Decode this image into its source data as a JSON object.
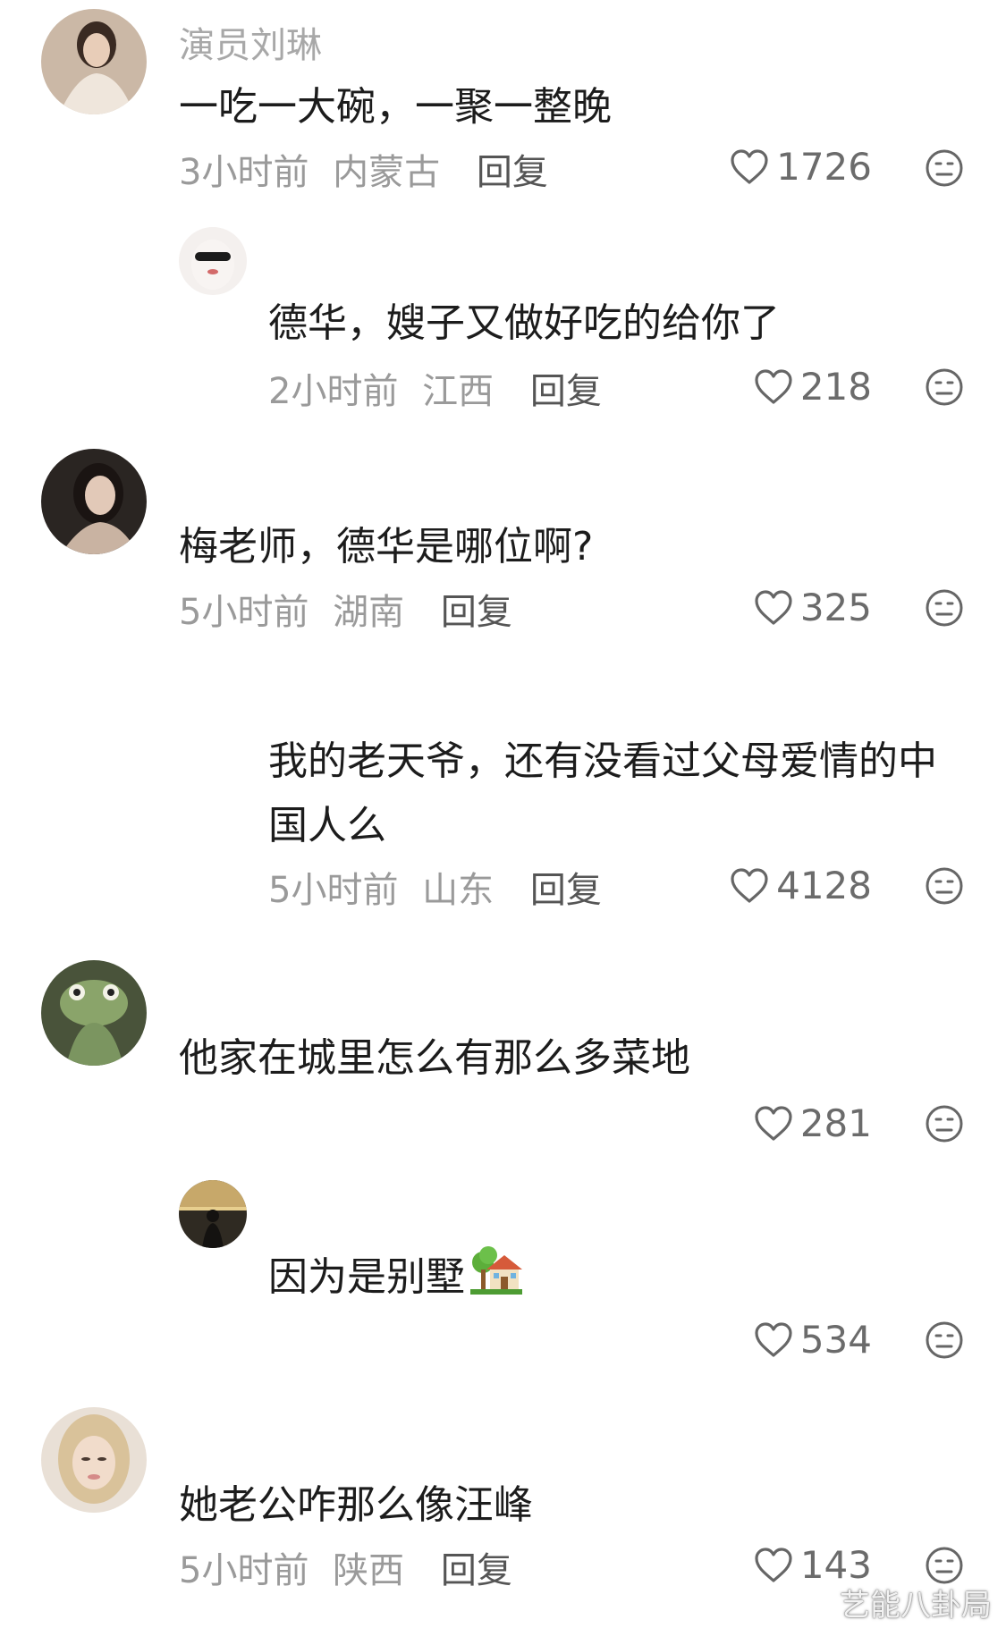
{
  "comments": [
    {
      "username": "演员刘琳",
      "text": "一吃一大碗，一聚一整晚",
      "time": "3小时前",
      "location": "内蒙古",
      "reply_label": "回复",
      "likes": "1726"
    },
    {
      "text": "德华，嫂子又做好吃的给你了",
      "time": "2小时前",
      "location": "江西",
      "reply_label": "回复",
      "likes": "218"
    },
    {
      "text": "梅老师，德华是哪位啊?",
      "time": "5小时前",
      "location": "湖南",
      "reply_label": "回复",
      "likes": "325"
    },
    {
      "text_line1": "我的老天爷，还有没看过父母爱情的中",
      "text_line2": "国人么",
      "time": "5小时前",
      "location": "山东",
      "reply_label": "回复",
      "likes": "4128"
    },
    {
      "text": "他家在城里怎么有那么多菜地",
      "likes": "281"
    },
    {
      "text": "因为是别墅",
      "emoji": "house-with-garden-icon",
      "likes": "534"
    },
    {
      "text": "她老公咋那么像汪峰",
      "time": "5小时前",
      "location": "陕西",
      "reply_label": "回复",
      "likes": "143"
    }
  ],
  "watermark": "艺能八卦局",
  "colors": {
    "meta_gray": "#9a9a9a",
    "username_gray": "#a8a8a8",
    "text": "#1c1c1c"
  }
}
